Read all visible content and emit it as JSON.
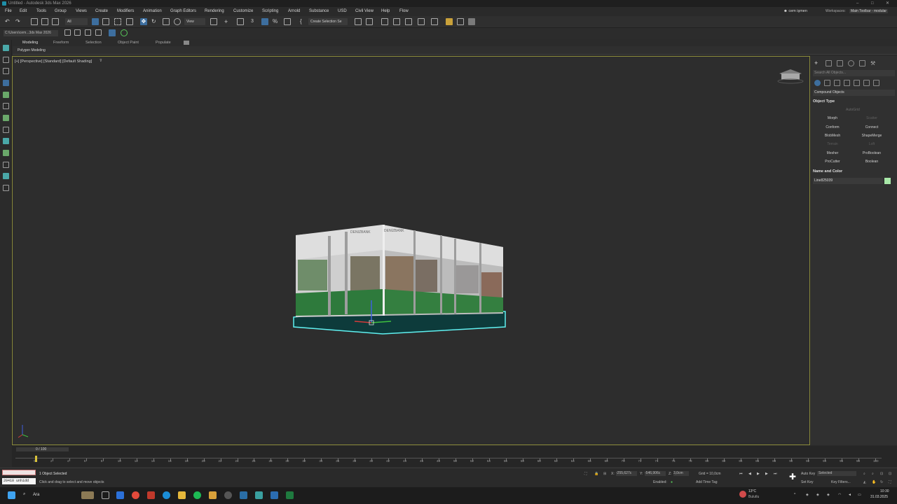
{
  "window": {
    "title": "Untitled - Autodesk 3ds Max 2026",
    "controls": [
      "–",
      "□",
      "✕"
    ]
  },
  "menubar": {
    "items": [
      "File",
      "Edit",
      "Tools",
      "Group",
      "Views",
      "Create",
      "Modifiers",
      "Animation",
      "Graph Editors",
      "Rendering",
      "Customize",
      "Scripting",
      "Arnold",
      "Substance",
      "USD",
      "Civil View",
      "Help",
      "Flow"
    ],
    "user": "cem işmen",
    "workspaces_label": "Workspaces:",
    "workspace": "Main Toolbar - modular"
  },
  "toolbar": {
    "filter": "All",
    "ref_coord": "View",
    "selection_set": "Create Selection Se"
  },
  "project": {
    "path": "C:\\Users\\cem...3ds Max 2026"
  },
  "ribbon": {
    "tabs": [
      "Modeling",
      "Freeform",
      "Selection",
      "Object Paint",
      "Populate"
    ],
    "panel": "Polygon Modeling"
  },
  "viewport": {
    "label": "[+] [Perspective] [Standard] [Default Shading]",
    "booth_brand": "DENIZBANK",
    "booth_brand2": "DENİZBANK"
  },
  "command_panel": {
    "search_placeholder": "Search All Objects...",
    "category": "Compound Objects",
    "object_type_header": "Object Type",
    "autogrid": "AutoGrid",
    "buttons": [
      {
        "label": "Morph",
        "enabled": true
      },
      {
        "label": "Scatter",
        "enabled": false
      },
      {
        "label": "Conform",
        "enabled": true
      },
      {
        "label": "Connect",
        "enabled": true
      },
      {
        "label": "BlobMesh",
        "enabled": true
      },
      {
        "label": "ShapeMerge",
        "enabled": true
      },
      {
        "label": "Terrain",
        "enabled": false
      },
      {
        "label": "Loft",
        "enabled": false
      },
      {
        "label": "Mesher",
        "enabled": true
      },
      {
        "label": "ProBoolean",
        "enabled": true
      },
      {
        "label": "ProCutter",
        "enabled": true
      },
      {
        "label": "Boolean",
        "enabled": true
      }
    ],
    "name_color_header": "Name and Color",
    "object_name": "Line825039",
    "object_color": "#a8e8a8"
  },
  "timeline": {
    "frame_counter": "0 / 100",
    "ruler": [
      "0",
      "2",
      "4",
      "6",
      "8",
      "10",
      "12",
      "14",
      "16",
      "18",
      "20",
      "22",
      "24",
      "26",
      "28",
      "30",
      "32",
      "34",
      "36",
      "38",
      "40",
      "42",
      "44",
      "46",
      "48",
      "50",
      "52",
      "54",
      "56",
      "58",
      "60",
      "62",
      "64",
      "66",
      "68",
      "70",
      "72",
      "74",
      "76",
      "78",
      "80",
      "82",
      "84",
      "86",
      "88",
      "90",
      "92",
      "94",
      "96",
      "98",
      "100"
    ]
  },
  "status": {
    "script_line1": "20410 unhidd",
    "selected": "1 Object Selected",
    "hint": "Click and drag to select and move objects",
    "x": "-255,627c",
    "y": "-546,906c",
    "z": "3,0cm",
    "x_label": "X:",
    "y_label": "Y:",
    "z_label": "Z:",
    "grid": "Grid = 10,0cm",
    "enabled": "Enabled:",
    "add_time_tag": "Add Time Tag",
    "auto_key": "Auto Key",
    "set_key": "Set Key",
    "selected_dd": "Selected",
    "key_filters": "Key Filters..."
  },
  "taskbar": {
    "search": "Ara",
    "weather_temp": "13°C",
    "weather_desc": "Bulutlu",
    "time": "10:30",
    "date": "31.03.2025"
  }
}
